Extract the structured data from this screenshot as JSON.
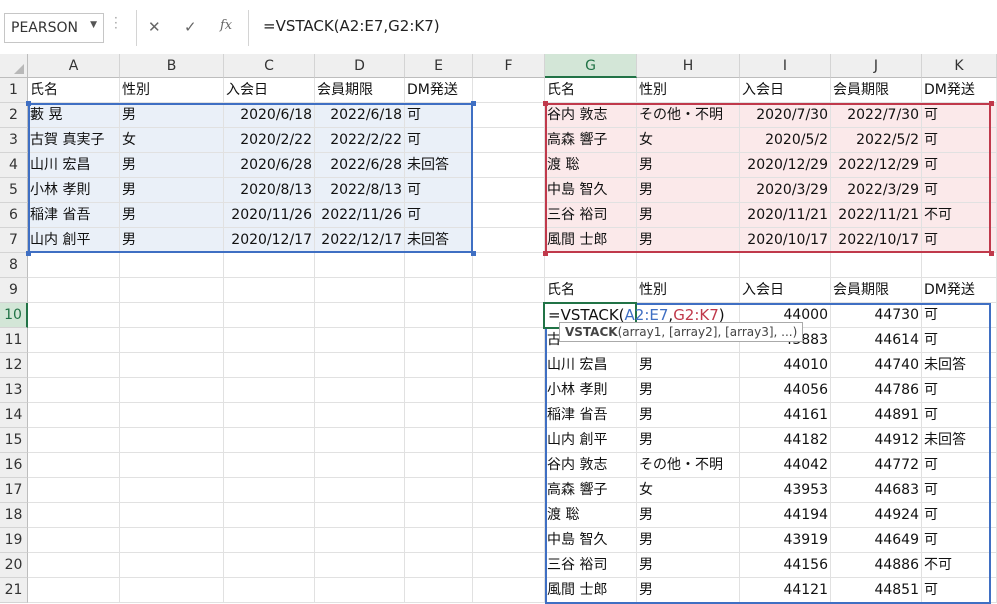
{
  "formula_bar": {
    "name_box": "PEARSON",
    "cancel_icon": "✕",
    "enter_icon": "✓",
    "fx_icon": "fx",
    "formula": "=VSTACK(A2:E7,G2:K7)"
  },
  "columns": [
    "A",
    "B",
    "C",
    "D",
    "E",
    "F",
    "G",
    "H",
    "I",
    "J",
    "K"
  ],
  "rows": [
    "1",
    "2",
    "3",
    "4",
    "5",
    "6",
    "7",
    "8",
    "9",
    "10",
    "11",
    "12",
    "13",
    "14",
    "15",
    "16",
    "17",
    "18",
    "19",
    "20",
    "21"
  ],
  "headers": [
    "氏名",
    "性別",
    "入会日",
    "会員期限",
    "DM発送"
  ],
  "table1": [
    [
      "藪 晃",
      "男",
      "2020/6/18",
      "2022/6/18",
      "可"
    ],
    [
      "古賀 真実子",
      "女",
      "2020/2/22",
      "2022/2/22",
      "可"
    ],
    [
      "山川 宏昌",
      "男",
      "2020/6/28",
      "2022/6/28",
      "未回答"
    ],
    [
      "小林 孝則",
      "男",
      "2020/8/13",
      "2022/8/13",
      "可"
    ],
    [
      "稲津 省吾",
      "男",
      "2020/11/26",
      "2022/11/26",
      "可"
    ],
    [
      "山内 創平",
      "男",
      "2020/12/17",
      "2022/12/17",
      "未回答"
    ]
  ],
  "table2": [
    [
      "谷内 敦志",
      "その他・不明",
      "2020/7/30",
      "2022/7/30",
      "可"
    ],
    [
      "高森 響子",
      "女",
      "2020/5/2",
      "2022/5/2",
      "可"
    ],
    [
      "渡 聡",
      "男",
      "2020/12/29",
      "2022/12/29",
      "可"
    ],
    [
      "中島 智久",
      "男",
      "2020/3/29",
      "2022/3/29",
      "可"
    ],
    [
      "三谷 裕司",
      "男",
      "2020/11/21",
      "2022/11/21",
      "不可"
    ],
    [
      "風間 士郎",
      "男",
      "2020/10/17",
      "2022/10/17",
      "可"
    ]
  ],
  "result": [
    [
      "",
      "",
      "44000",
      "44730",
      "可"
    ],
    [
      "古",
      "",
      "43883",
      "44614",
      "可"
    ],
    [
      "山川 宏昌",
      "男",
      "44010",
      "44740",
      "未回答"
    ],
    [
      "小林 孝則",
      "男",
      "44056",
      "44786",
      "可"
    ],
    [
      "稲津 省吾",
      "男",
      "44161",
      "44891",
      "可"
    ],
    [
      "山内 創平",
      "男",
      "44182",
      "44912",
      "未回答"
    ],
    [
      "谷内 敦志",
      "その他・不明",
      "44042",
      "44772",
      "可"
    ],
    [
      "高森 響子",
      "女",
      "43953",
      "44683",
      "可"
    ],
    [
      "渡 聡",
      "男",
      "44194",
      "44924",
      "可"
    ],
    [
      "中島 智久",
      "男",
      "43919",
      "44649",
      "可"
    ],
    [
      "三谷 裕司",
      "男",
      "44156",
      "44886",
      "不可"
    ],
    [
      "風間 士郎",
      "男",
      "44121",
      "44851",
      "可"
    ]
  ],
  "editor": {
    "prefix": "=VSTACK(",
    "ref1": "A2:E7",
    "comma": ",",
    "ref2": "G2:K7",
    "suffix": ")"
  },
  "tooltip": {
    "fn": "VSTACK",
    "args": "(array1, [array2], [array3], ...)"
  },
  "colors": {
    "accent": "#217346",
    "range1": "#3f6fc3",
    "range2": "#c0394b"
  }
}
